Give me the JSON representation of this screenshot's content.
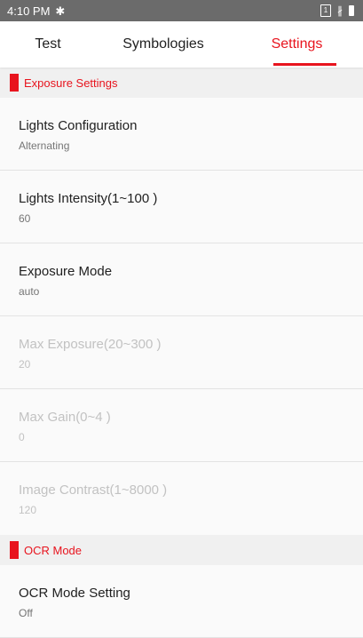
{
  "status_bar": {
    "time": "4:10 PM",
    "settings_glyph": "gear-icon",
    "sim_label": "1"
  },
  "tabs": [
    {
      "label": "Test",
      "active": false
    },
    {
      "label": "Symbologies",
      "active": false
    },
    {
      "label": "Settings",
      "active": true
    }
  ],
  "accent_color": "#e8141e",
  "sections": [
    {
      "title": "Exposure Settings",
      "items": [
        {
          "title": "Lights Configuration",
          "summary": "Alternating",
          "enabled": true
        },
        {
          "title": "Lights Intensity(1~100 )",
          "summary": "60",
          "enabled": true
        },
        {
          "title": "Exposure Mode",
          "summary": "auto",
          "enabled": true
        },
        {
          "title": "Max Exposure(20~300 )",
          "summary": "20",
          "enabled": false
        },
        {
          "title": "Max Gain(0~4 )",
          "summary": "0",
          "enabled": false
        },
        {
          "title": "Image Contrast(1~8000 )",
          "summary": "120",
          "enabled": false
        }
      ]
    },
    {
      "title": "OCR Mode",
      "items": [
        {
          "title": "OCR Mode Setting",
          "summary": "Off",
          "enabled": true
        }
      ]
    }
  ]
}
